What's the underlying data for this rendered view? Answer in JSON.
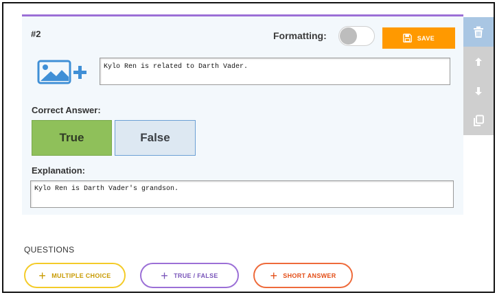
{
  "question": {
    "number": "#2",
    "formatting_label": "Formatting:",
    "formatting_enabled": false,
    "save_label": "SAVE",
    "text": "Kylo Ren is related to Darth Vader.",
    "image_icon": "add-image-icon"
  },
  "answer": {
    "label": "Correct Answer:",
    "true_label": "True",
    "false_label": "False",
    "selected": "True"
  },
  "explanation": {
    "label": "Explanation:",
    "text": "Kylo Ren is Darth Vader's grandson."
  },
  "side_tools": {
    "icons": [
      "trash-icon",
      "arrow-up-icon",
      "arrow-down-icon",
      "copy-icon"
    ]
  },
  "questions_section": {
    "title": "QUESTIONS",
    "buttons": {
      "multiple_choice": "MULTIPLE CHOICE",
      "true_false": "TRUE / FALSE",
      "short_answer": "SHORT ANSWER"
    }
  },
  "colors": {
    "accent_purple": "#9b6fd6",
    "save_orange": "#ff9900",
    "true_green": "#8fc05a",
    "false_blue": "#dde8f2",
    "delete_blue": "#a9c6e3",
    "mc_yellow": "#f4cb28",
    "sa_orange": "#ee6a3a"
  }
}
